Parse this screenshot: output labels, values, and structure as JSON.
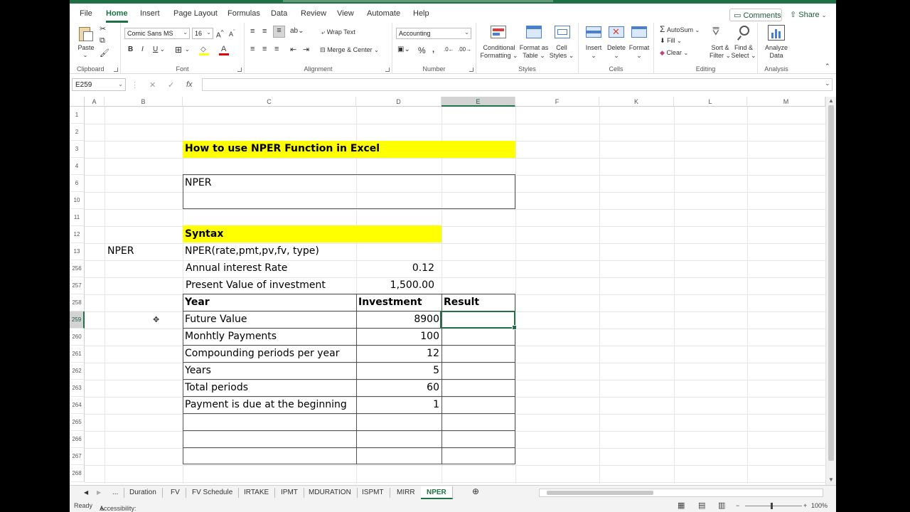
{
  "menu": {
    "tabs": [
      "File",
      "Home",
      "Insert",
      "Page Layout",
      "Formulas",
      "Data",
      "Review",
      "View",
      "Automate",
      "Help"
    ],
    "active": "Home",
    "comments": "Comments",
    "share": "Share"
  },
  "ribbon": {
    "clipboard": {
      "paste": "Paste",
      "label": "Clipboard"
    },
    "font": {
      "name": "Comic Sans MS",
      "size": "16",
      "label": "Font",
      "bold": "B",
      "italic": "I",
      "underline": "U"
    },
    "alignment": {
      "wrap": "Wrap Text",
      "merge": "Merge & Center",
      "label": "Alignment"
    },
    "number": {
      "format": "Accounting",
      "label": "Number"
    },
    "styles": {
      "conditional1": "Conditional",
      "conditional2": "Formatting",
      "table1": "Format as",
      "table2": "Table",
      "cell1": "Cell",
      "cell2": "Styles",
      "label": "Styles"
    },
    "cells": {
      "insert": "Insert",
      "delete": "Delete",
      "format": "Format",
      "label": "Cells"
    },
    "editing": {
      "autosum": "AutoSum",
      "fill": "Fill",
      "clear": "Clear",
      "sort1": "Sort &",
      "sort2": "Filter",
      "find1": "Find &",
      "find2": "Select",
      "label": "Editing"
    },
    "analysis": {
      "analyze1": "Analyze",
      "analyze2": "Data",
      "label": "Analysis"
    }
  },
  "formula_bar": {
    "name_box": "E259",
    "fx": "fx"
  },
  "columns": [
    "A",
    "B",
    "C",
    "D",
    "E",
    "F",
    "K",
    "L",
    "M"
  ],
  "rows": [
    "1",
    "2",
    "3",
    "4",
    "6",
    "10",
    "11",
    "12",
    "13",
    "256",
    "257",
    "258",
    "259",
    "260",
    "261",
    "262",
    "263",
    "264",
    "265",
    "266",
    "267",
    "268"
  ],
  "sheet": {
    "title": "How to use NPER Function in Excel",
    "nper_box": "NPER",
    "syntax": "Syntax",
    "b13": "NPER",
    "c13": "NPER(rate,pmt,pv,fv, type)",
    "rate_label": "Annual interest Rate",
    "rate_value": "0.12",
    "pv_label": "Present Value of investment",
    "pv_value": "1,500.00",
    "header": {
      "year": "Year",
      "investment": "Investment",
      "result": "Result"
    },
    "table": [
      {
        "label": "Future Value",
        "value": "8900"
      },
      {
        "label": "Monhtly Payments",
        "value": "100"
      },
      {
        "label": "Compounding periods per year",
        "value": "12"
      },
      {
        "label": "Years",
        "value": "5"
      },
      {
        "label": "Total periods",
        "value": "60"
      },
      {
        "label": "Payment is due at the beginning",
        "value": "1"
      }
    ]
  },
  "sheet_tabs": [
    "...",
    "Duration",
    "FV",
    "FV Schedule",
    "IRTAKE",
    "IPMT",
    "MDURATION",
    "ISPMT",
    "MIRR",
    "NPER"
  ],
  "active_sheet": "NPER",
  "status": {
    "ready": "Ready",
    "accessibility": "Accessibility: Investigate",
    "zoom": "100%"
  }
}
